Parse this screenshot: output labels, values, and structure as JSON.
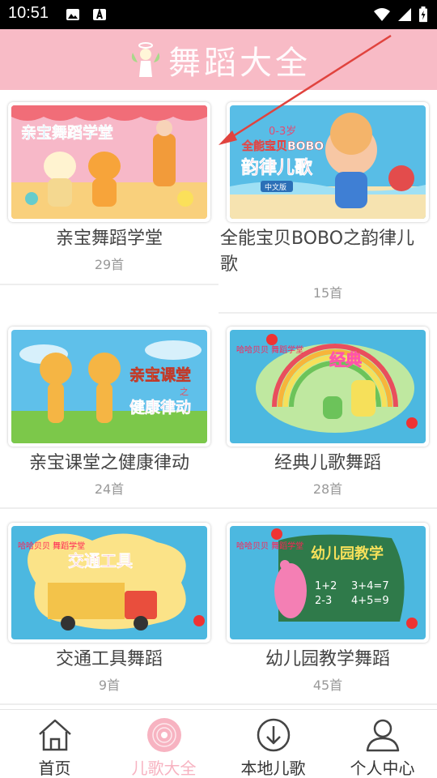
{
  "status_bar": {
    "time": "10:51"
  },
  "header": {
    "title": "舞蹈大全"
  },
  "categories": [
    {
      "name": "亲宝舞蹈学堂",
      "count": "29首",
      "thumb_text": "亲宝舞蹈学堂",
      "thumb_bg": "#f4b7c8"
    },
    {
      "name": "全能宝贝BOBO之韵律儿歌",
      "name_line1": "全能宝贝BOBO之韵律儿",
      "name_line2": "歌",
      "count": "15首",
      "thumb_text_top": "0-3岁",
      "thumb_text1": "全能宝贝BOBO",
      "thumb_text2": "韵律儿歌",
      "thumb_tag": "中文版",
      "thumb_bg": "#4fb8e3"
    },
    {
      "name": "亲宝课堂之健康律动",
      "count": "24首",
      "thumb_text1": "亲宝课堂",
      "thumb_text_small": "之",
      "thumb_text2": "健康律动",
      "thumb_bg": "#5fc0ea"
    },
    {
      "name": "经典儿歌舞蹈",
      "count": "28首",
      "thumb_brand": "哈哈贝贝 舞蹈学堂",
      "thumb_text": "经典",
      "thumb_bg": "#4cb8e0"
    },
    {
      "name": "交通工具舞蹈",
      "count": "9首",
      "thumb_brand": "哈哈贝贝 舞蹈学堂",
      "thumb_text": "交通工具",
      "thumb_bg": "#4cb8e0"
    },
    {
      "name": "幼儿园教学舞蹈",
      "count": "45首",
      "thumb_brand": "哈哈贝贝 舞蹈学堂",
      "thumb_text": "幼儿园教学",
      "thumb_math1": "1+2",
      "thumb_math2": "2-3",
      "thumb_math3": "3+4=7",
      "thumb_math4": "4+5=9",
      "thumb_bg": "#4cb8e0"
    }
  ],
  "bottom_nav": [
    {
      "label": "首页",
      "icon": "home-icon"
    },
    {
      "label": "儿歌大全",
      "icon": "disc-icon",
      "active": true
    },
    {
      "label": "本地儿歌",
      "icon": "download-icon"
    },
    {
      "label": "个人中心",
      "icon": "person-icon"
    }
  ],
  "colors": {
    "header_bg": "#f8bbc6",
    "accent": "#f7b3c1",
    "arrow": "#e0433e"
  }
}
